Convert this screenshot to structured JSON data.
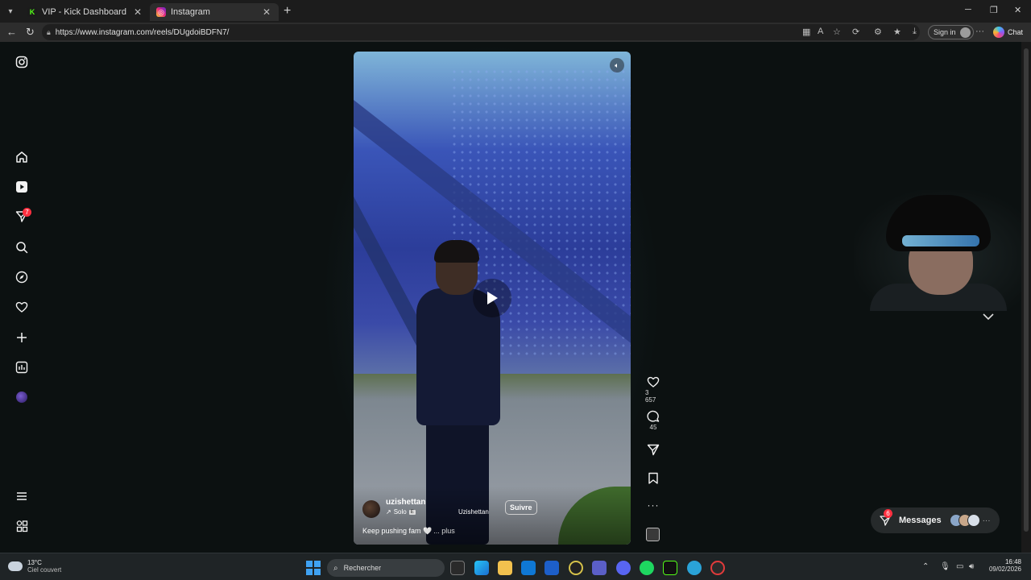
{
  "browser": {
    "tabs": [
      {
        "label": "VIP - Kick Dashboard",
        "active": false
      },
      {
        "label": "Instagram",
        "active": true
      }
    ],
    "url": "https://www.instagram.com/reels/DUgdoiBDFN7/",
    "sign_in_label": "Sign in",
    "chat_label": "Chat"
  },
  "sidebar": {
    "notifications_badge": "7"
  },
  "reel": {
    "username": "uzishettan",
    "audio_label": "Solo",
    "audio_badge": "E",
    "owner_label": "Uzishettan",
    "follow_label": "Suivre",
    "caption": "Keep pushing fam 🤍",
    "caption_more": "... plus",
    "likes": "3 657",
    "comments": "45"
  },
  "messages": {
    "label": "Messages",
    "badge": "6"
  },
  "taskbar": {
    "weather_temp": "13°C",
    "weather_desc": "Ciel couvert",
    "search_placeholder": "Rechercher",
    "time": "16:48",
    "date": "09/02/2026"
  },
  "colors": {
    "accent": "#0095f6",
    "badge_red": "#ff3040",
    "page_bg": "#0c1111"
  }
}
